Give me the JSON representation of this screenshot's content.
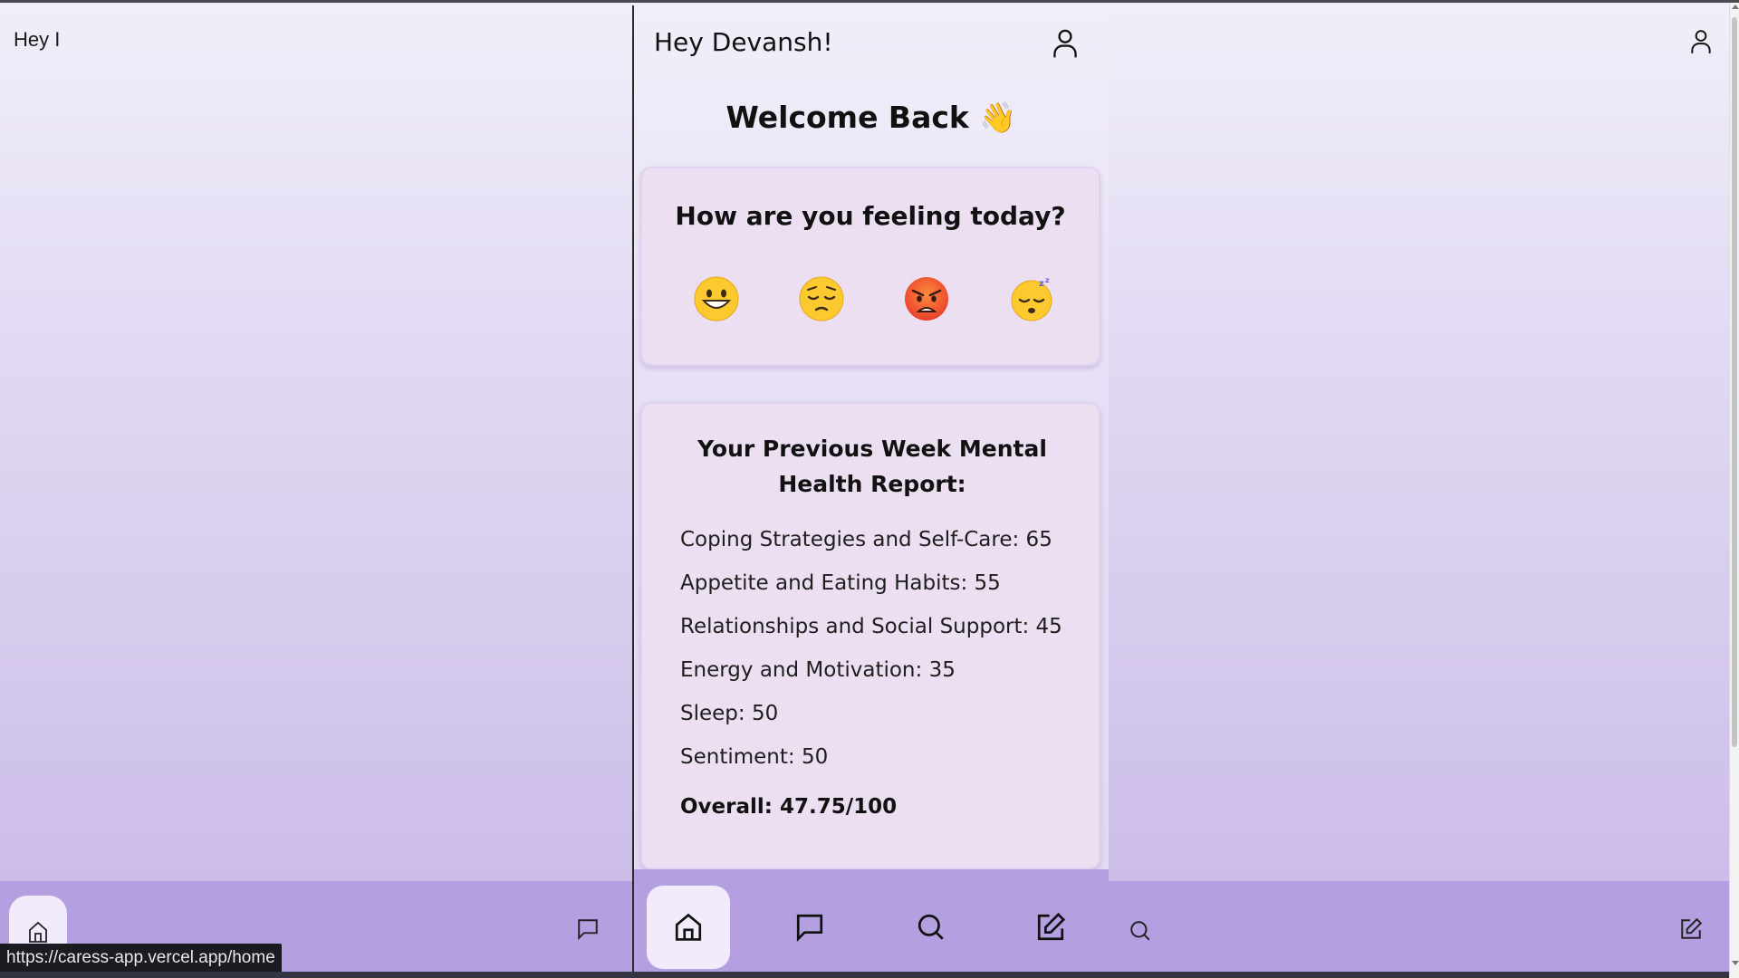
{
  "background_app": {
    "header_text": "Hey I"
  },
  "phone": {
    "greeting": "Hey Devansh!",
    "welcome": "Welcome Back 👋",
    "mood_card": {
      "title": "How are you feeling today?",
      "emojis": [
        "grinning-face",
        "pensive-face",
        "angry-face",
        "sleeping-face"
      ]
    },
    "report_card": {
      "title": "Your Previous Week Mental Health Report:",
      "items": [
        "Coping Strategies and Self-Care: 65",
        "Appetite and Eating Habits: 55",
        "Relationships and Social Support: 45",
        "Energy and Motivation: 35",
        "Sleep: 50",
        "Sentiment: 50"
      ],
      "overall": "Overall: 47.75/100"
    },
    "nav": [
      "home",
      "chat",
      "search",
      "edit"
    ]
  },
  "status_bar": {
    "url": "https://caress-app.vercel.app/home"
  },
  "colors": {
    "nav_bg": "#b49fe0",
    "card_bg": "#ecdff2",
    "active_nav_bg": "#f1ebfb"
  }
}
